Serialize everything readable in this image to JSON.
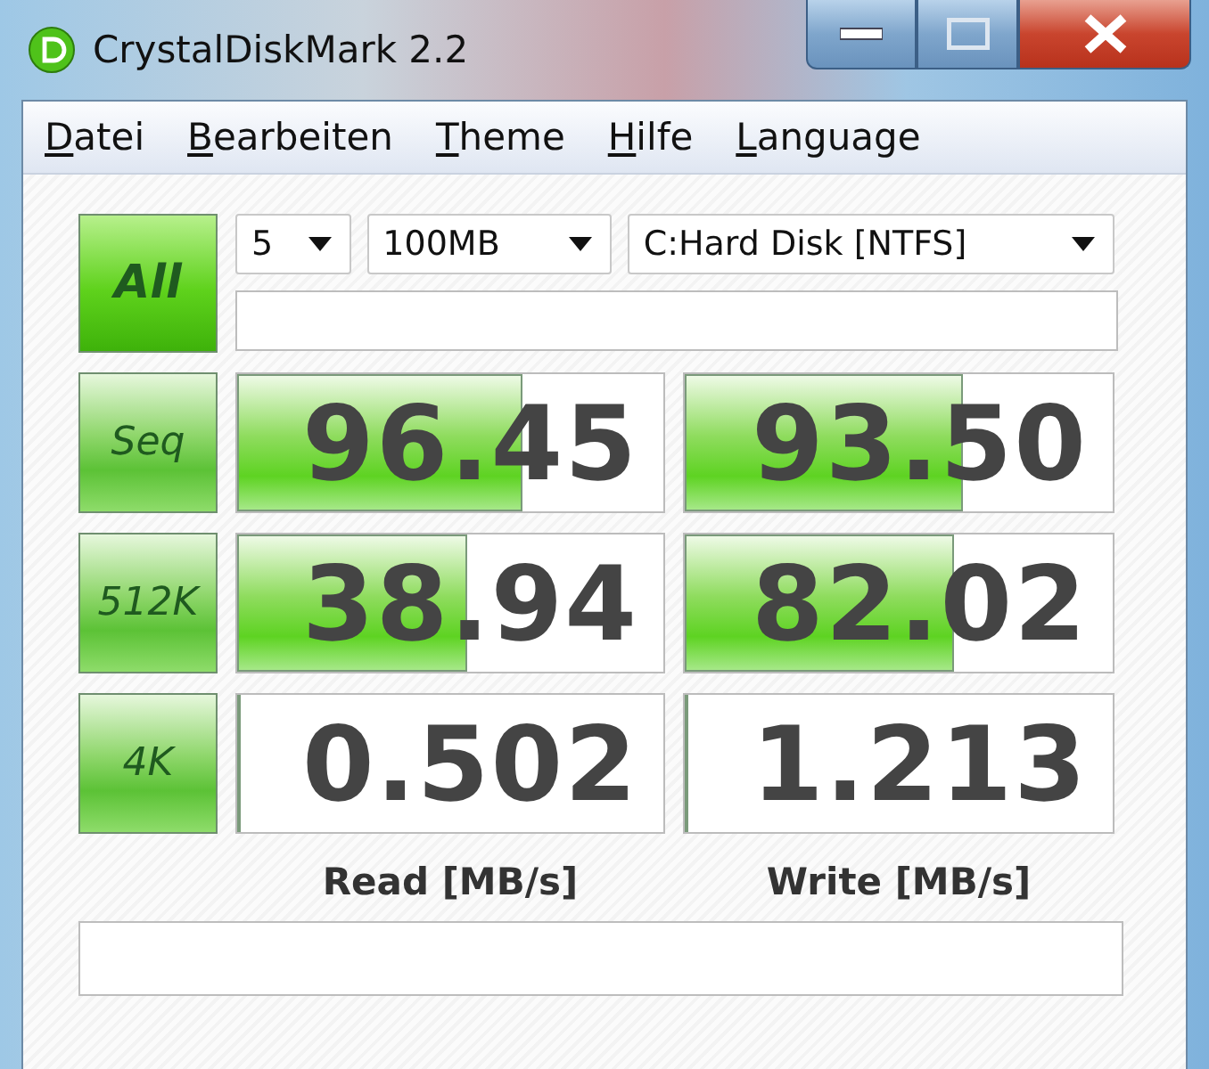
{
  "window": {
    "title": "CrystalDiskMark 2.2"
  },
  "menu": [
    "Datei",
    "Bearbeiten",
    "Theme",
    "Hilfe",
    "Language"
  ],
  "all_button": "All",
  "selectors": [
    {
      "value": "5"
    },
    {
      "value": "100MB"
    },
    {
      "value": "C:Hard Disk [NTFS]"
    }
  ],
  "tests": [
    {
      "label": "Seq",
      "read": {
        "value": "96.45",
        "level": 0.67
      },
      "write": {
        "value": "93.50",
        "level": 0.65
      }
    },
    {
      "label": "512K",
      "read": {
        "value": "38.94",
        "level": 0.54
      },
      "write": {
        "value": "82.02",
        "level": 0.63
      }
    },
    {
      "label": "4K",
      "read": {
        "value": "0.502",
        "level": 0
      },
      "write": {
        "value": "1.213",
        "level": 0.01
      }
    }
  ],
  "columns": [
    "Read [MB/s]",
    "Write [MB/s]"
  ]
}
